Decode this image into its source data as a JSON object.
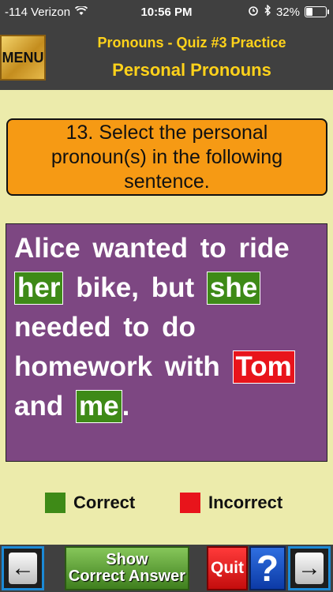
{
  "status_bar": {
    "carrier": "-114 Verizon",
    "time": "10:56 PM",
    "battery_percent": "32%",
    "battery_level": 0.32
  },
  "header": {
    "menu_label": "MENU",
    "title": "Pronouns - Quiz #3 Practice",
    "subtitle": "Personal Pronouns"
  },
  "question": {
    "text": "13. Select the personal pronoun(s) in the following sentence."
  },
  "sentence": {
    "words": [
      {
        "text": "Alice",
        "state": "none"
      },
      {
        "text": "wanted",
        "state": "none"
      },
      {
        "text": "to",
        "state": "none"
      },
      {
        "text": "ride",
        "state": "none"
      },
      {
        "text": "her",
        "state": "correct"
      },
      {
        "text": "bike,",
        "state": "none"
      },
      {
        "text": "but",
        "state": "none"
      },
      {
        "text": "she",
        "state": "correct"
      },
      {
        "text": "needed",
        "state": "none"
      },
      {
        "text": "to",
        "state": "none"
      },
      {
        "text": "do",
        "state": "none"
      },
      {
        "text": "homework",
        "state": "none"
      },
      {
        "text": "with",
        "state": "none"
      },
      {
        "text": "Tom",
        "state": "incorrect"
      },
      {
        "text": "and",
        "state": "none"
      },
      {
        "text": "me",
        "state": "correct"
      }
    ],
    "end_punctuation": "."
  },
  "legend": {
    "correct_label": "Correct",
    "incorrect_label": "Incorrect",
    "correct_color": "#3e8a17",
    "incorrect_color": "#e8141b"
  },
  "toolbar": {
    "back_icon": "←",
    "show_answer_line1": "Show",
    "show_answer_line2": "Correct Answer",
    "quit_label": "Quit",
    "help_label": "?",
    "forward_icon": "→"
  }
}
